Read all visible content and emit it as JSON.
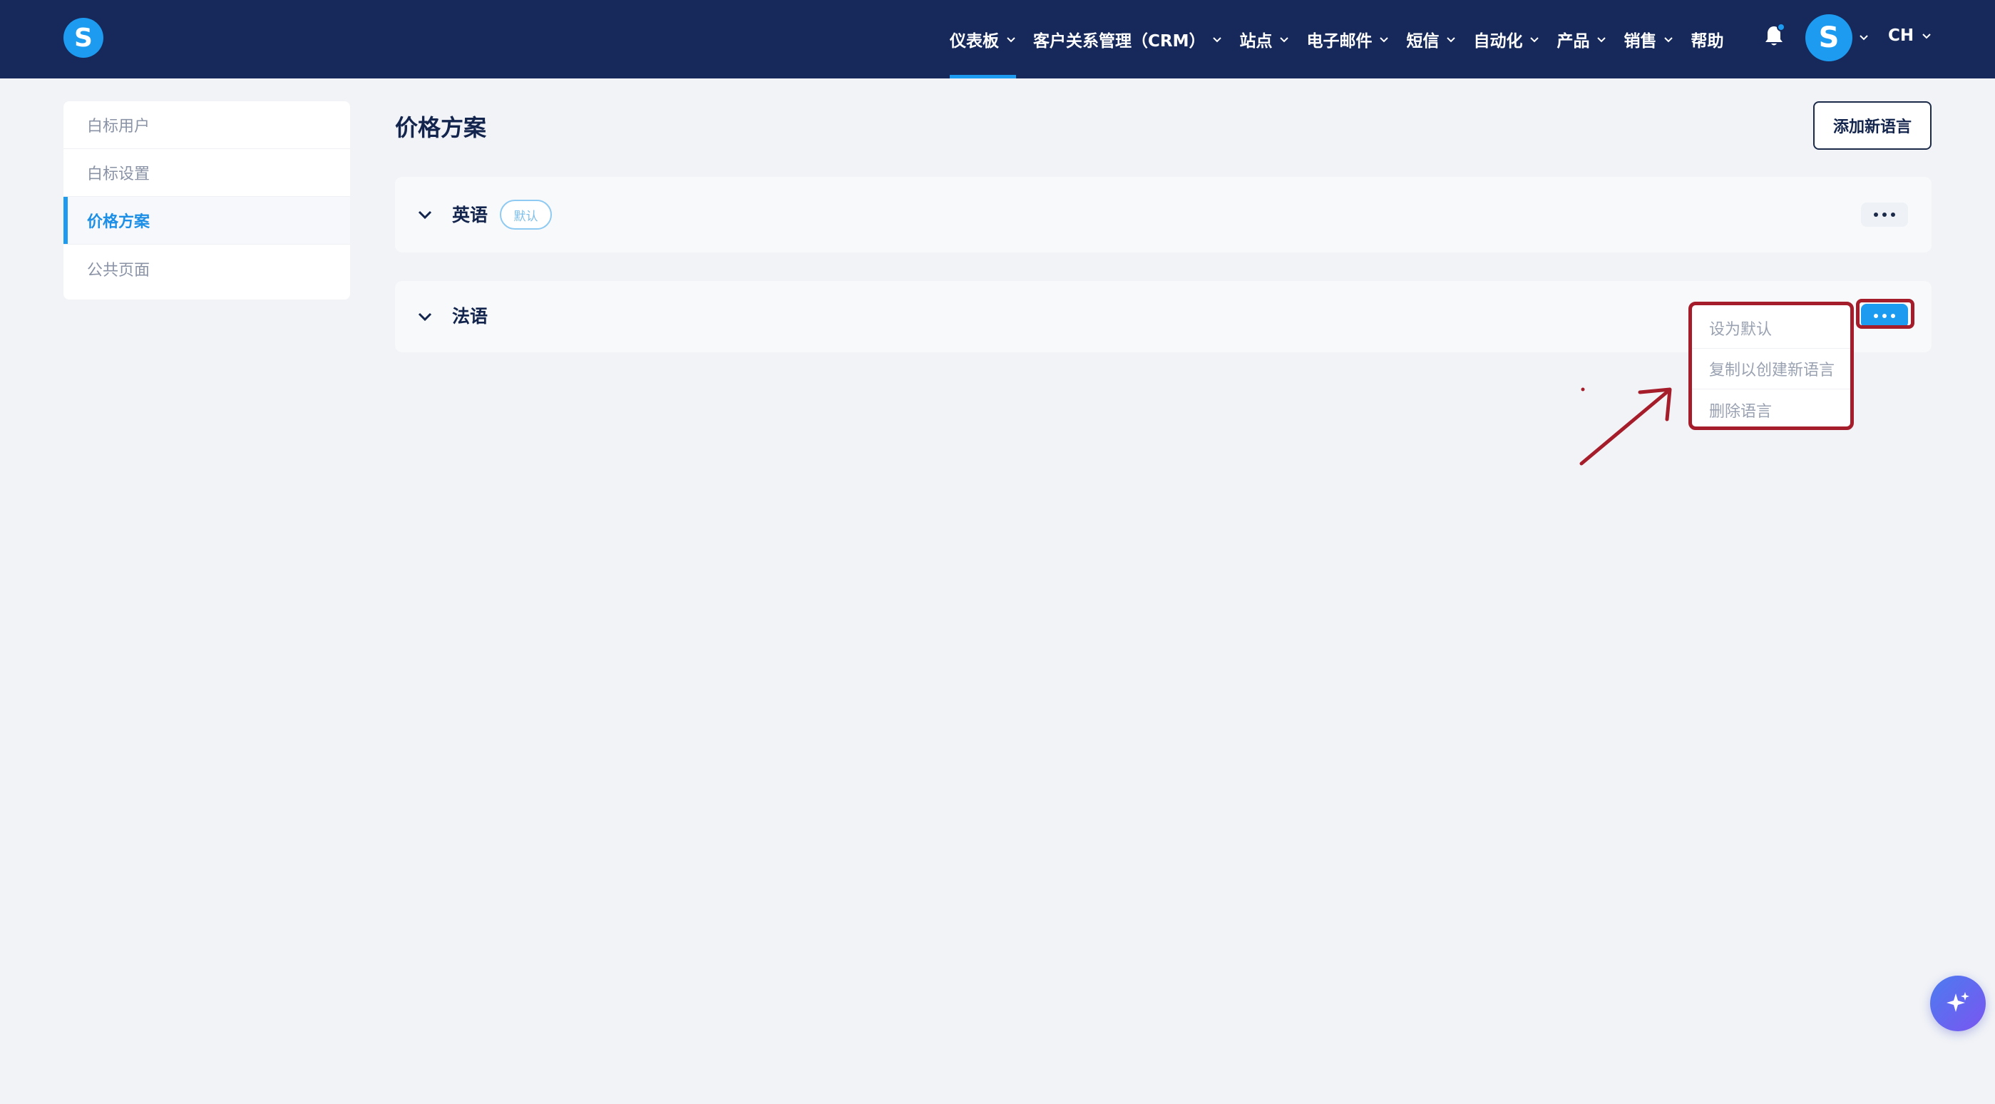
{
  "brand": {
    "logo_letter": "S"
  },
  "nav": {
    "items": [
      {
        "label": "仪表板",
        "active": true
      },
      {
        "label": "客户关系管理（CRM）"
      },
      {
        "label": "站点"
      },
      {
        "label": "电子邮件"
      },
      {
        "label": "短信"
      },
      {
        "label": "自动化"
      },
      {
        "label": "产品"
      },
      {
        "label": "销售"
      }
    ],
    "help_label": "帮助",
    "avatar_letter": "S",
    "language": "CH"
  },
  "sidebar": {
    "items": [
      {
        "label": "白标用户"
      },
      {
        "label": "白标设置"
      },
      {
        "label": "价格方案",
        "active": true
      },
      {
        "label": "公共页面"
      }
    ]
  },
  "main": {
    "title": "价格方案",
    "add_button_label": "添加新语言",
    "languages": [
      {
        "name": "英语",
        "badge": "默认"
      },
      {
        "name": "法语"
      }
    ],
    "dropdown": {
      "items": [
        {
          "label": "设为默认"
        },
        {
          "label": "复制以创建新语言"
        },
        {
          "label": "删除语言"
        }
      ]
    }
  },
  "colors": {
    "topbar": "#16295a",
    "accent": "#1d9bf0",
    "annotation": "#a51d2a"
  }
}
